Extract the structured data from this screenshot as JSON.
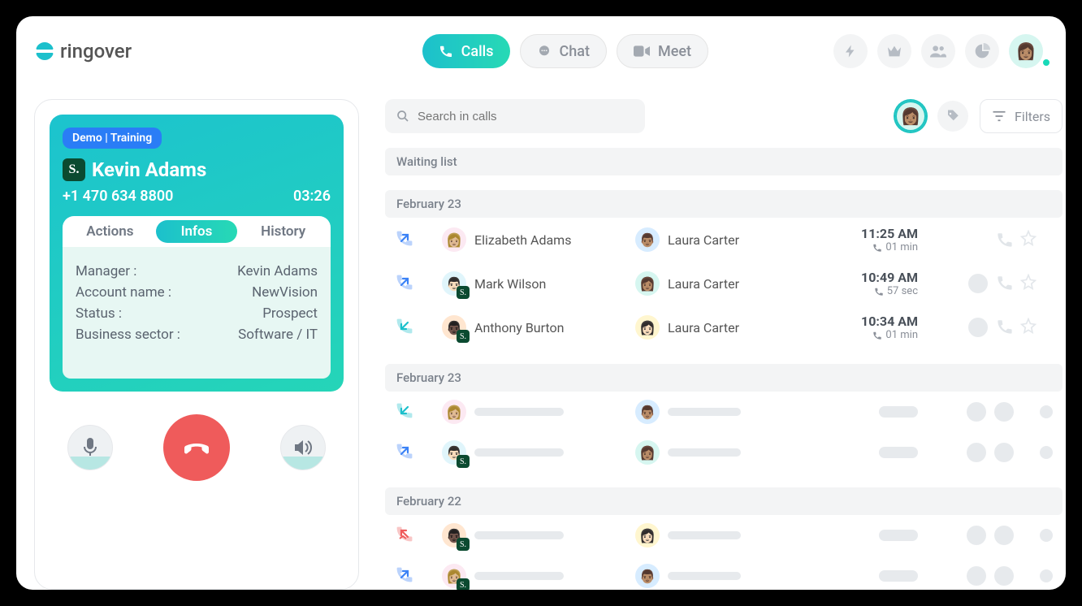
{
  "brand": "ringover",
  "nav": {
    "calls": "Calls",
    "chat": "Chat",
    "meet": "Meet"
  },
  "toolbar": {
    "search_placeholder": "Search in calls",
    "filters": "Filters"
  },
  "headers": {
    "waiting": "Waiting list",
    "d1": "February 23",
    "d2": "February 23",
    "d3": "February 22"
  },
  "call_card": {
    "badge": "Demo | Training",
    "name": "Kevin Adams",
    "phone": "+1 470 634 8800",
    "duration": "03:26",
    "tabs": {
      "actions": "Actions",
      "infos": "Infos",
      "history": "History"
    },
    "info": {
      "manager_label": "Manager :",
      "manager_value": "Kevin Adams",
      "account_label": "Account name :",
      "account_value": "NewVision",
      "status_label": "Status :",
      "status_value": "Prospect",
      "sector_label": "Business sector :",
      "sector_value": "Software / IT"
    }
  },
  "calls": [
    {
      "dir": "out",
      "p1": "Elizabeth Adams",
      "p2": "Laura Carter",
      "time": "11:25 AM",
      "dur": "01 min",
      "msg": false,
      "s": false
    },
    {
      "dir": "out",
      "p1": "Mark Wilson",
      "p2": "Laura Carter",
      "time": "10:49 AM",
      "dur": "57 sec",
      "msg": true,
      "s": true
    },
    {
      "dir": "in",
      "p1": "Anthony Burton",
      "p2": "Laura Carter",
      "time": "10:34 AM",
      "dur": "01 min",
      "msg": true,
      "s": true
    }
  ],
  "skeleton": [
    {
      "dir": "in",
      "s": false
    },
    {
      "dir": "out",
      "s": true
    }
  ],
  "skeleton2": [
    {
      "dir": "missed",
      "s": true
    },
    {
      "dir": "out",
      "s": true
    }
  ]
}
